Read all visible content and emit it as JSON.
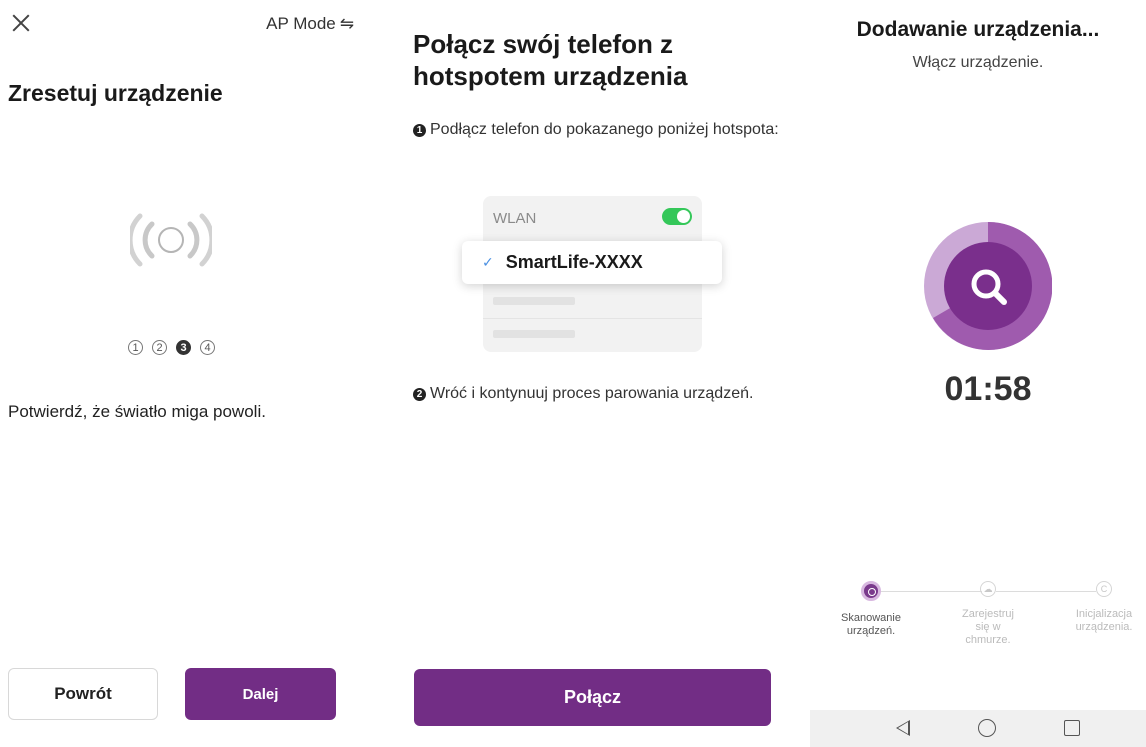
{
  "screen1": {
    "mode_label": "AP Mode",
    "title": "Zresetuj urządzenie",
    "steps": [
      "1",
      "2",
      "3",
      "4"
    ],
    "active_step": 3,
    "description": "Potwierdź, że światło miga powoli.",
    "back_label": "Powrót",
    "next_label": "Dalej"
  },
  "screen2": {
    "title": "Połącz swój telefon z hotspotem urządzenia",
    "step1_number": "1",
    "step1_text": "Podłącz telefon do pokazanego poniżej hotspota:",
    "wlan_label": "WLAN",
    "wlan_enabled": true,
    "ssid": "SmartLife-XXXX",
    "step2_number": "2",
    "step2_text": "Wróć i kontynuuj proces parowania urządzeń.",
    "connect_label": "Połącz"
  },
  "screen3": {
    "title": "Dodawanie urządzenia...",
    "subtitle": "Włącz urządzenie.",
    "timer": "01:58",
    "progress_steps": [
      {
        "label": "Skanowanie urządzeń.",
        "active": true
      },
      {
        "label": "Zarejestruj się w chmurze.",
        "active": false
      },
      {
        "label": "Inicjalizacja urządzenia.",
        "active": false
      }
    ]
  },
  "colors": {
    "accent": "#722d85",
    "toggle_on": "#34c759",
    "check": "#4a90e2"
  }
}
